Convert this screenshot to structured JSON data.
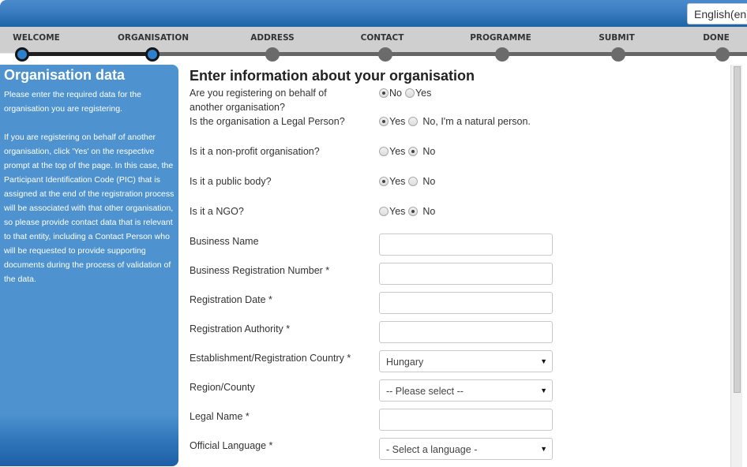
{
  "header": {
    "language_button": "English(en)"
  },
  "steps": [
    {
      "label": "WELCOME",
      "state": "done"
    },
    {
      "label": "ORGANISATION",
      "state": "current"
    },
    {
      "label": "ADDRESS",
      "state": "pending"
    },
    {
      "label": "CONTACT",
      "state": "pending"
    },
    {
      "label": "PROGRAMME",
      "state": "pending"
    },
    {
      "label": "SUBMIT",
      "state": "pending"
    },
    {
      "label": "DONE",
      "state": "pending"
    }
  ],
  "sidebar": {
    "title": "Organisation data",
    "paragraph1": "Please enter the required data for the organisation you are registering.",
    "paragraph2": "If you are registering on behalf of another organisation, click 'Yes' on the respective prompt at the top of the page. In this case, the Participant Identification Code (PIC) that is assigned at the end of the registration process will be associated with that other organisation, so please provide contact data that is relevant to that entity, including a Contact Person who will be requested to provide supporting documents during the process of validation of the data."
  },
  "main": {
    "title": "Enter information about your organisation",
    "questions": [
      {
        "label": "Are you registering on behalf of another organisation?",
        "options": [
          "No",
          "Yes"
        ],
        "selected": "No"
      },
      {
        "label": "Is the organisation a Legal Person?",
        "options": [
          "Yes",
          "No, I'm a natural person."
        ],
        "selected": "Yes"
      },
      {
        "label": "Is it a non-profit organisation?",
        "options": [
          "Yes",
          "No"
        ],
        "selected": "No"
      },
      {
        "label": "Is it a public body?",
        "options": [
          "Yes",
          "No"
        ],
        "selected": "Yes"
      },
      {
        "label": "Is it a NGO?",
        "options": [
          "Yes",
          "No"
        ],
        "selected": "No"
      }
    ],
    "fields": [
      {
        "label": "Business Name",
        "type": "text",
        "value": ""
      },
      {
        "label": "Business Registration Number *",
        "type": "text",
        "value": ""
      },
      {
        "label": "Registration Date *",
        "type": "text",
        "value": ""
      },
      {
        "label": "Registration Authority *",
        "type": "text",
        "value": ""
      },
      {
        "label": "Establishment/Registration Country *",
        "type": "select",
        "value": "Hungary"
      },
      {
        "label": "Region/County",
        "type": "select",
        "value": "-- Please select --"
      },
      {
        "label": "Legal Name *",
        "type": "text",
        "value": ""
      },
      {
        "label": "Official Language *",
        "type": "select",
        "value": "- Select a language -"
      }
    ]
  },
  "icons": {
    "dropdown_arrow": "▼"
  },
  "colors": {
    "header_blue": "#3a7cc0",
    "sidebar_blue": "#4e93cf",
    "step_done": "#2e7fcc",
    "step_pending": "#6b6b6b"
  }
}
